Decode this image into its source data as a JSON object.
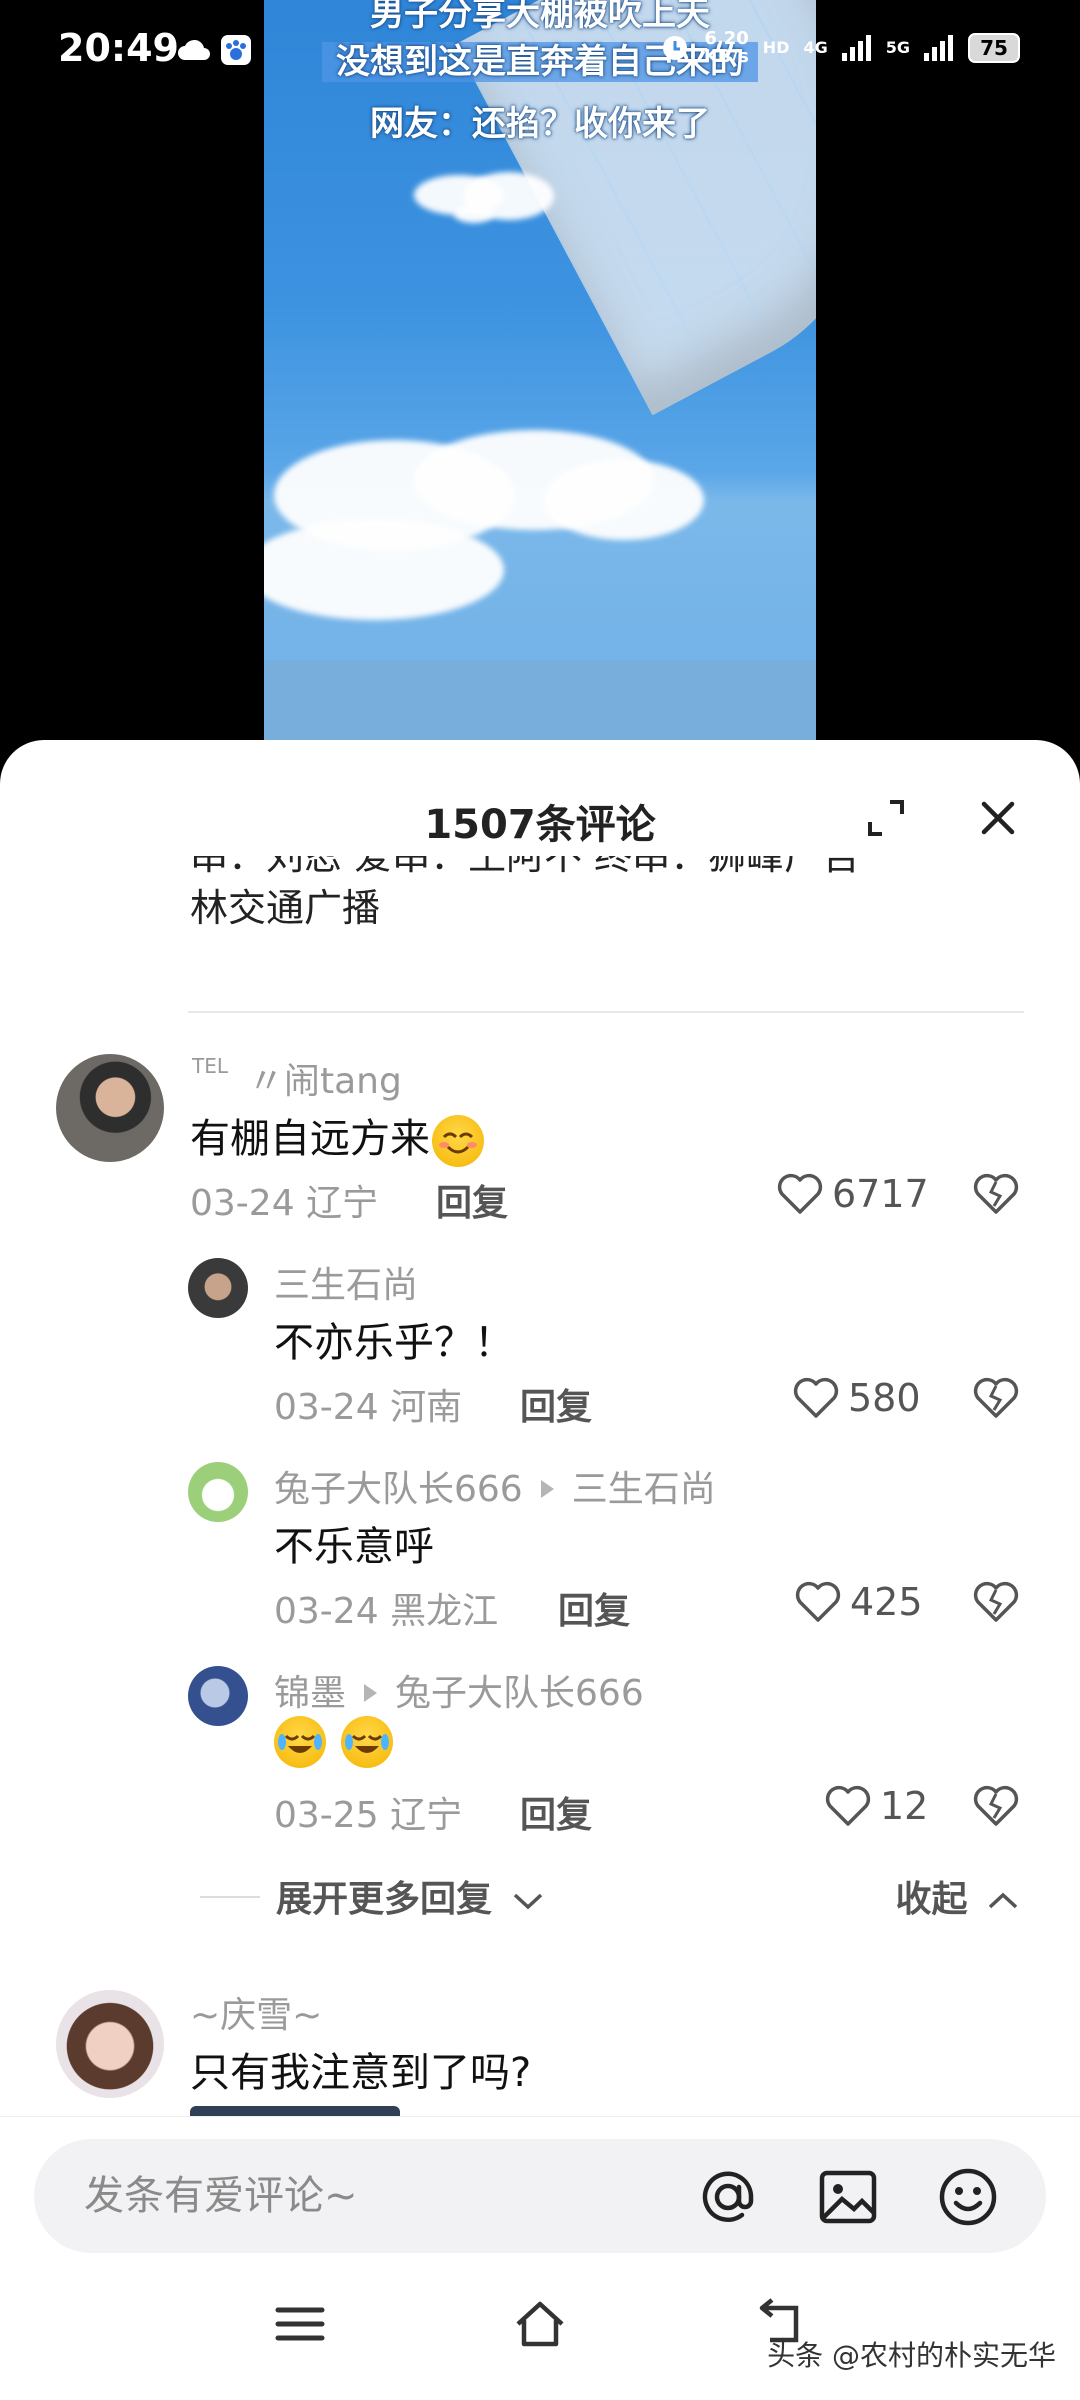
{
  "status_bar": {
    "time": "20:49",
    "net_speed_value": "6.20",
    "net_speed_unit": "KB/s",
    "sim_label": "HD",
    "signal_4g": "4G",
    "signal_5g": "5G",
    "battery": "75"
  },
  "video": {
    "caption_top": "男子分享大棚被吹上天",
    "caption_main": "没想到这是直奔着自己来的",
    "caption_sub": "网友：还掐？收你来了"
  },
  "sheet": {
    "title": "1507条评论",
    "previous_comment_clipped": "串：刘忍 爱串：王阿不 终串：狮峰广吉",
    "previous_comment_tail": "林交通广播"
  },
  "comments": [
    {
      "username": "〃闹tang",
      "username_prefix": "TEL",
      "text": "有棚自远方来",
      "date": "03-24",
      "location": "辽宁",
      "reply_label": "回复",
      "likes": "6717"
    },
    {
      "username": "三生石尚",
      "text": "不亦乐乎？！",
      "date": "03-24",
      "location": "河南",
      "reply_label": "回复",
      "likes": "580"
    },
    {
      "username": "兔子大队长666",
      "reply_to": "三生石尚",
      "text": "不乐意呼",
      "date": "03-24",
      "location": "黑龙江",
      "reply_label": "回复",
      "likes": "425"
    },
    {
      "username": "锦墨",
      "reply_to": "兔子大队长666",
      "text": "",
      "date": "03-25",
      "location": "辽宁",
      "reply_label": "回复",
      "likes": "12"
    },
    {
      "username": "~庆雪~",
      "text": "只有我注意到了吗?"
    }
  ],
  "thread_controls": {
    "expand_more": "展开更多回复",
    "collapse": "收起"
  },
  "input": {
    "placeholder": "发条有爱评论~"
  },
  "watermark": "头条 @农村的朴实无华",
  "colors": {
    "sheet_bg": "#ffffff",
    "muted_text": "#9a9a9a",
    "input_bg": "#f2f2f4"
  }
}
